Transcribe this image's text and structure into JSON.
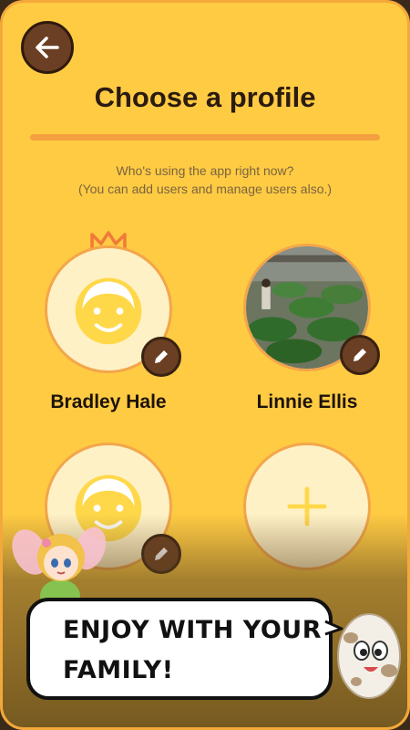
{
  "header": {
    "title": "Choose a profile"
  },
  "subtitle": {
    "line1": "Who's using the app right now?",
    "line2": "(You can add users and manage users also.)"
  },
  "profiles": [
    {
      "name": "Bradley Hale",
      "owner": true,
      "avatar": "default-face"
    },
    {
      "name": "Linnie Ellis",
      "owner": false,
      "avatar": "photo"
    },
    {
      "name": "",
      "owner": false,
      "avatar": "default-face"
    }
  ],
  "add_profile": {
    "icon": "plus-icon"
  },
  "banner": {
    "text": "ENJOY WITH YOUR FAMILY!"
  },
  "colors": {
    "background": "#ffcb43",
    "accent": "#f5a040",
    "button": "#6b3f23",
    "face": "#ffd84a"
  }
}
